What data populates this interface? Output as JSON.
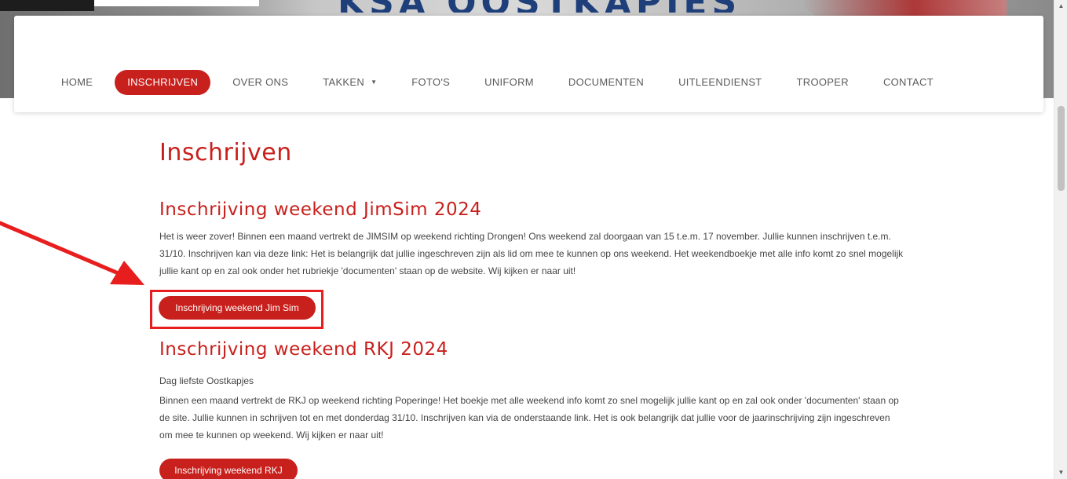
{
  "hero": {
    "brand_text": "KSA OOSTKAPJES"
  },
  "nav": {
    "items": [
      {
        "label": "HOME",
        "active": false
      },
      {
        "label": "INSCHRIJVEN",
        "active": true
      },
      {
        "label": "OVER ONS",
        "active": false
      },
      {
        "label": "TAKKEN",
        "active": false,
        "has_dropdown": true
      },
      {
        "label": "FOTO'S",
        "active": false
      },
      {
        "label": "UNIFORM",
        "active": false
      },
      {
        "label": "DOCUMENTEN",
        "active": false
      },
      {
        "label": "UITLEENDIENST",
        "active": false
      },
      {
        "label": "TROOPER",
        "active": false
      },
      {
        "label": "CONTACT",
        "active": false
      }
    ],
    "dropdown_caret": "▼"
  },
  "main": {
    "page_title": "Inschrijven",
    "sections": [
      {
        "title": "Inschrijving weekend JimSim 2024",
        "paragraphs": [
          "Het is weer zover! Binnen een maand vertrekt de JIMSIM op weekend richting Drongen! Ons weekend zal doorgaan van 15 t.e.m. 17 november. Jullie kunnen inschrijven t.e.m. 31/10. Inschrijven kan via deze link:  Het is belangrijk dat jullie ingeschreven zijn als lid om mee te kunnen op ons weekend. Het weekendboekje met alle info komt zo snel mogelijk jullie kant op en zal ook onder het rubriekje 'documenten' staan op de website. Wij kijken er naar uit!"
        ],
        "button_label": "Inschrijving weekend Jim Sim"
      },
      {
        "title": "Inschrijving weekend RKJ 2024",
        "paragraphs": [
          "Dag liefste Oostkapjes",
          "Binnen  een maand vertrekt de RKJ op weekend richting Poperinge! Het boekje met alle weekend info komt zo snel mogelijk jullie kant op en zal ook onder 'documenten' staan op de site. Jullie kunnen in schrijven tot en met donderdag 31/10. Inschrijven kan via de onderstaande link. Het is ook belangrijk dat jullie voor de jaarinschrijving zijn ingeschreven om mee te kunnen op weekend. Wij kijken er naar uit!"
        ],
        "button_label": "Inschrijving weekend RKJ"
      }
    ]
  },
  "scrollbar": {
    "up_arrow": "▲",
    "down_arrow": "▼"
  },
  "colors": {
    "accent_red": "#c8201c",
    "annotation_red": "#e81e1e",
    "nav_text": "#5a5a5a",
    "body_text": "#444444"
  }
}
